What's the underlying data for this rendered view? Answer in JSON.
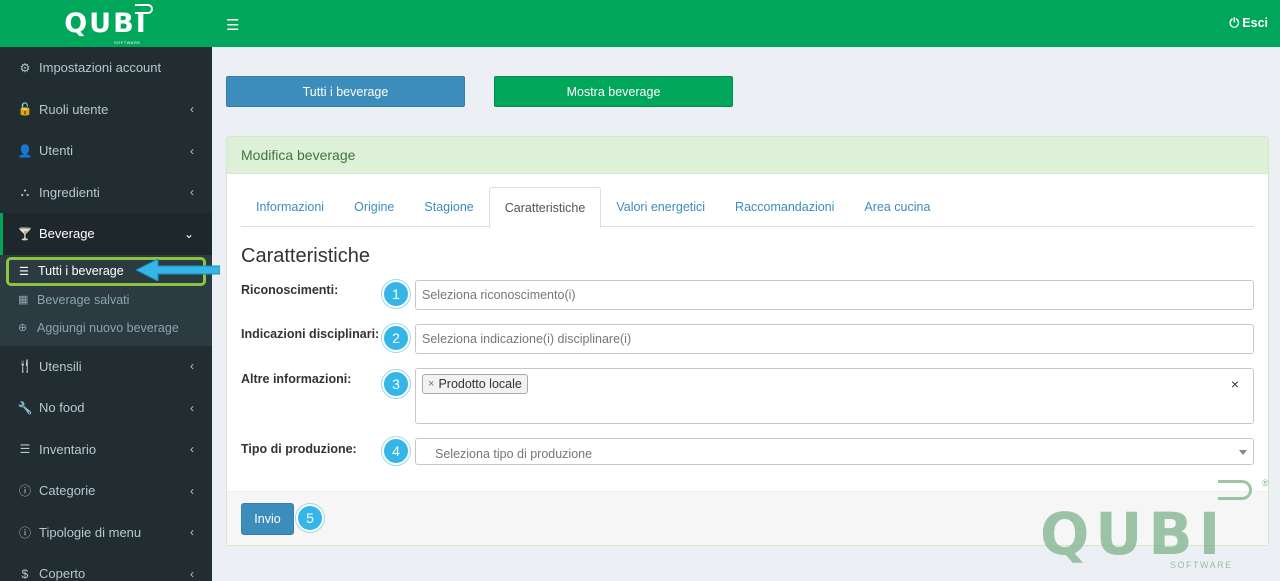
{
  "brand": {
    "logo_text": "QUBI",
    "logo_sub": "SOFTWARE"
  },
  "topbar": {
    "menu_icon": "hamburger-icon",
    "logout_label": "Esci",
    "logout_icon": "power-icon"
  },
  "sidebar": {
    "items": [
      {
        "label": "Impostazioni account",
        "icon": "gear-icon"
      },
      {
        "label": "Ruoli utente",
        "icon": "unlock-icon"
      },
      {
        "label": "Utenti",
        "icon": "user-icon"
      },
      {
        "label": "Ingredienti",
        "icon": "sitemap-icon"
      },
      {
        "label": "Beverage",
        "icon": "cocktail-glass-icon"
      },
      {
        "label": "Utensili",
        "icon": "cutlery-icon"
      },
      {
        "label": "No food",
        "icon": "wrench-icon"
      },
      {
        "label": "Inventario",
        "icon": "list-icon"
      },
      {
        "label": "Categorie",
        "icon": "info-icon"
      },
      {
        "label": "Tipologie di menu",
        "icon": "info-icon"
      },
      {
        "label": "Coperto",
        "icon": "dollar-icon"
      }
    ],
    "beverage_submenu": [
      {
        "label": "Tutti i beverage",
        "icon": "list-icon"
      },
      {
        "label": "Beverage salvati",
        "icon": "archive-icon"
      },
      {
        "label": "Aggiungi nuovo beverage",
        "icon": "plus-circle-icon"
      }
    ]
  },
  "actions": {
    "all_label": "Tutti i beverage",
    "show_label": "Mostra beverage"
  },
  "panel": {
    "title": "Modifica beverage",
    "tabs": [
      "Informazioni",
      "Origine",
      "Stagione",
      "Caratteristiche",
      "Valori energetici",
      "Raccomandazioni",
      "Area cucina"
    ],
    "active_tab": "Caratteristiche",
    "section_title": "Caratteristiche",
    "fields": {
      "riconoscimenti": {
        "label": "Riconoscimenti:",
        "placeholder": "Seleziona riconoscimento(i)",
        "badge": "1"
      },
      "indicazioni": {
        "label": "Indicazioni disciplinari:",
        "placeholder": "Seleziona indicazione(i) disciplinare(i)",
        "badge": "2"
      },
      "altre": {
        "label": "Altre informazioni:",
        "tag": "Prodotto locale",
        "tag_remove": "×",
        "clear": "×",
        "badge": "3"
      },
      "produzione": {
        "label": "Tipo di produzione:",
        "placeholder": "Seleziona tipo di produzione",
        "badge": "4"
      }
    },
    "submit_label": "Invio",
    "submit_badge": "5"
  },
  "watermark": {
    "text": "QUBI",
    "sub": "SOFTWARE",
    "reg": "®"
  },
  "colors": {
    "brand_green": "#00a65a",
    "sidebar_bg": "#222d32",
    "primary_blue": "#3c8dbc",
    "badge_blue": "#35b6e6",
    "highlight_green": "#8bc53f"
  }
}
